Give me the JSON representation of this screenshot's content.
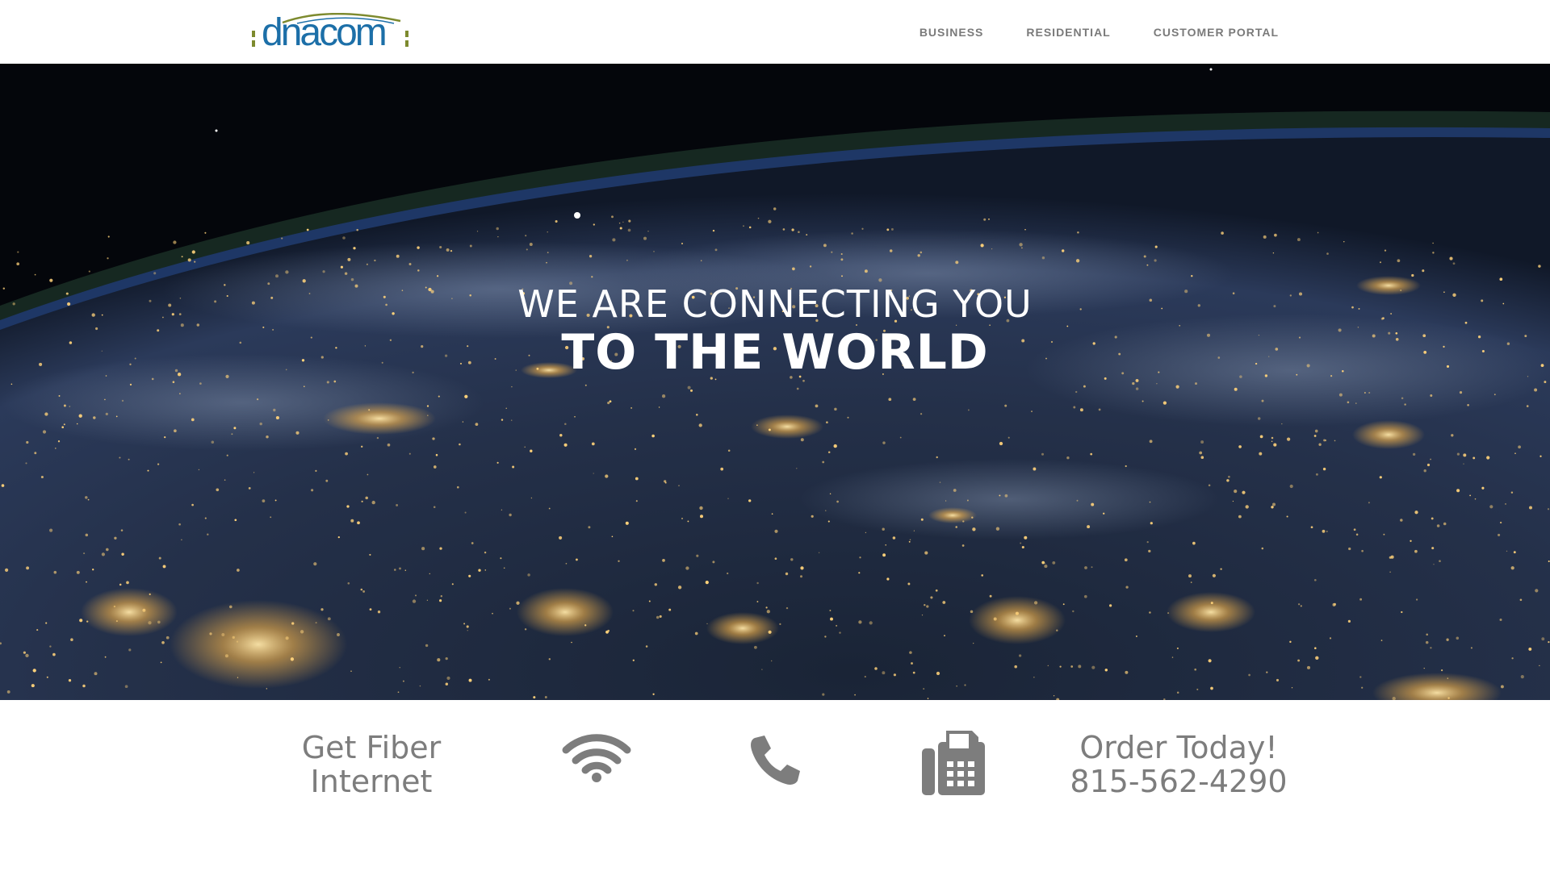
{
  "header": {
    "logo": {
      "text": "dnacom",
      "icon": "dnacom-logo"
    },
    "nav": [
      {
        "label": "BUSINESS"
      },
      {
        "label": "RESIDENTIAL"
      },
      {
        "label": "CUSTOMER PORTAL"
      }
    ]
  },
  "hero": {
    "line1": "WE ARE CONNECTING YOU",
    "line2": "TO THE WORLD",
    "background": "earth-at-night-from-space"
  },
  "features": {
    "fiber_line1": "Get Fiber",
    "fiber_line2": "Internet",
    "icons": [
      "wifi-icon",
      "phone-icon",
      "fax-icon"
    ],
    "order_line1": "Order Today!",
    "order_line2": "815-562-4290"
  },
  "colors": {
    "nav_text": "#7a7a7a",
    "feature_text": "#7d7d7d",
    "logo_blue": "#1c6fa8",
    "logo_green": "#7d8a2e"
  }
}
